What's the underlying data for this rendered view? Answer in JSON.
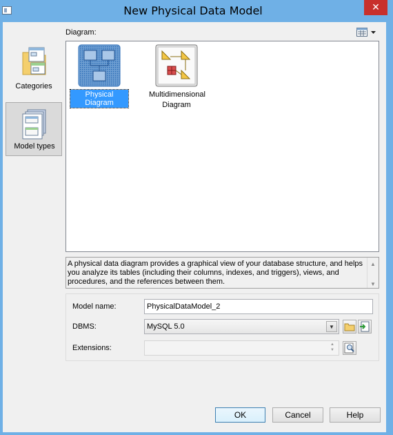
{
  "window": {
    "title": "New Physical Data Model",
    "close_glyph": "✕"
  },
  "sidebar": {
    "items": [
      {
        "label": "Categories",
        "icon": "categories-icon",
        "selected": false
      },
      {
        "label": "Model types",
        "icon": "model-types-icon",
        "selected": true
      }
    ]
  },
  "diagram": {
    "label": "Diagram:",
    "view_icon": "grid-view-icon",
    "tiles": [
      {
        "label": "Physical Diagram",
        "icon": "physical-diagram-icon",
        "selected": true
      },
      {
        "label_line1": "Multidimensional",
        "label_line2": "Diagram",
        "icon": "multidimensional-diagram-icon",
        "selected": false
      }
    ]
  },
  "description": {
    "text": "A physical data diagram provides a graphical view of your database structure, and helps you analyze its tables (including their columns, indexes, and triggers), views, and procedures, and the references between them."
  },
  "form": {
    "model_name": {
      "label": "Model name:",
      "value": "PhysicalDataModel_2"
    },
    "dbms": {
      "label": "DBMS:",
      "value": "MySQL 5.0"
    },
    "extensions": {
      "label": "Extensions:",
      "value": ""
    }
  },
  "buttons": {
    "ok": "OK",
    "cancel": "Cancel",
    "help": "Help"
  },
  "colors": {
    "titlebar": "#6fb0e6",
    "selection": "#3399ff",
    "close": "#c8302c"
  }
}
